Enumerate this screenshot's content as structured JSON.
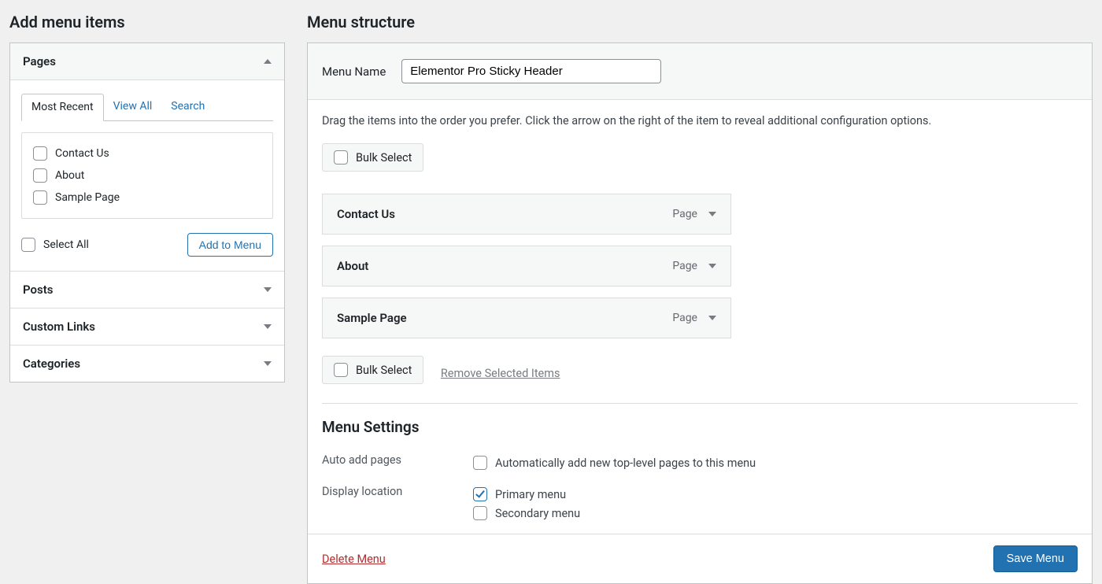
{
  "left": {
    "heading": "Add menu items",
    "pages_section": {
      "title": "Pages",
      "expanded": true,
      "tabs": [
        "Most Recent",
        "View All",
        "Search"
      ],
      "active_tab": "Most Recent",
      "items": [
        {
          "label": "Contact Us",
          "checked": false
        },
        {
          "label": "About",
          "checked": false
        },
        {
          "label": "Sample Page",
          "checked": false
        }
      ],
      "select_all": "Select All",
      "add_button": "Add to Menu"
    },
    "collapsed_sections": [
      "Posts",
      "Custom Links",
      "Categories"
    ]
  },
  "right": {
    "heading": "Menu structure",
    "menu_name_label": "Menu Name",
    "menu_name_value": "Elementor Pro Sticky Header",
    "hint": "Drag the items into the order you prefer. Click the arrow on the right of the item to reveal additional configuration options.",
    "bulk_label": "Bulk Select",
    "items": [
      {
        "title": "Contact Us",
        "type": "Page"
      },
      {
        "title": "About",
        "type": "Page"
      },
      {
        "title": "Sample Page",
        "type": "Page"
      }
    ],
    "remove_selected": "Remove Selected Items",
    "settings": {
      "title": "Menu Settings",
      "auto_add": {
        "label": "Auto add pages",
        "option": "Automatically add new top-level pages to this menu",
        "checked": false
      },
      "display_location": {
        "label": "Display location",
        "options": [
          {
            "label": "Primary menu",
            "checked": true
          },
          {
            "label": "Secondary menu",
            "checked": false
          }
        ]
      }
    },
    "delete_label": "Delete Menu",
    "save_label": "Save Menu"
  },
  "colors": {
    "link": "#2271b1",
    "danger": "#b32d2e"
  }
}
